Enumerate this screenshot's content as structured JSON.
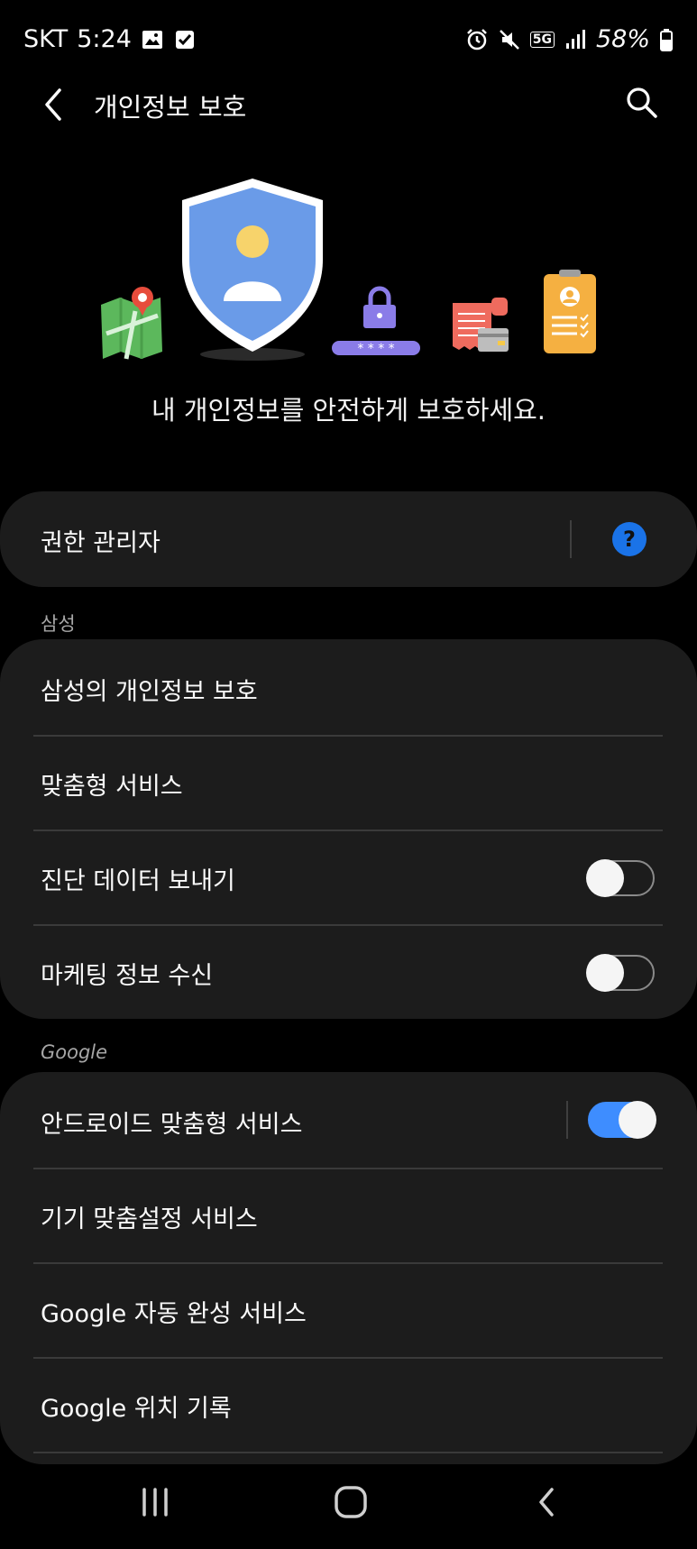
{
  "status_bar": {
    "carrier": "SKT",
    "time": "5:24",
    "network": "5G",
    "battery": "58%",
    "icons": [
      "image-icon",
      "check-box-icon",
      "alarm-icon",
      "mute-icon",
      "5g-icon",
      "signal-icon",
      "battery-icon"
    ]
  },
  "header": {
    "title": "개인정보 보호"
  },
  "hero": {
    "tagline": "내 개인정보를 안전하게 보호하세요."
  },
  "permission_card": {
    "label": "권한 관리자"
  },
  "samsung_section": {
    "header": "삼성",
    "items": [
      {
        "label": "삼성의 개인정보 보호"
      },
      {
        "label": "맞춤형 서비스"
      },
      {
        "label": "진단 데이터 보내기",
        "toggle": false
      },
      {
        "label": "마케팅 정보 수신",
        "toggle": false
      }
    ]
  },
  "google_section": {
    "header": "Google",
    "items": [
      {
        "label": "안드로이드 맞춤형 서비스",
        "toggle": true
      },
      {
        "label": "기기 맞춤설정 서비스"
      },
      {
        "label": "Google 자동 완성 서비스"
      },
      {
        "label": "Google 위치 기록"
      }
    ]
  },
  "colors": {
    "accent": "#3e8dff",
    "card": "#1c1c1c",
    "help": "#1a73e8"
  }
}
